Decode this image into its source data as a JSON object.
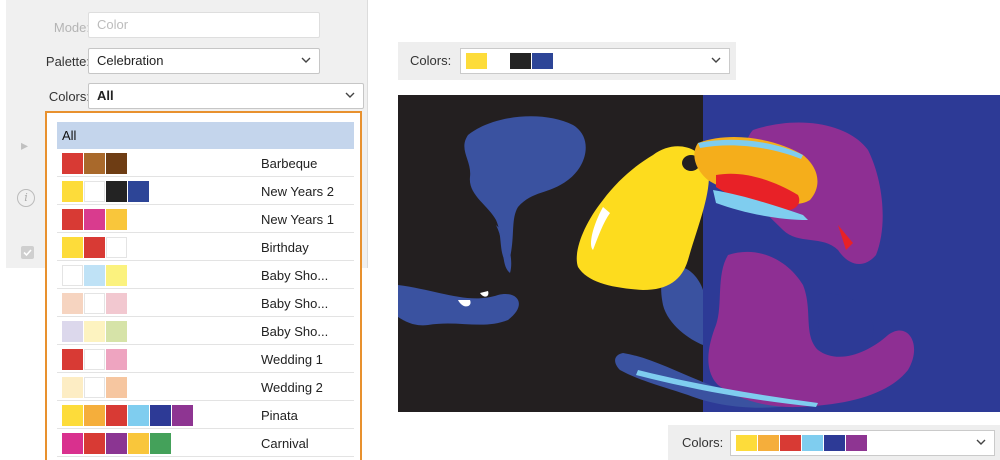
{
  "panel": {
    "mode": {
      "label": "Mode:",
      "value": "Color"
    },
    "palette": {
      "label": "Palette:",
      "value": "Celebration"
    },
    "colors": {
      "label": "Colors:",
      "value": "All"
    }
  },
  "dropdown": {
    "all_label": "All",
    "items": [
      {
        "name": "Barbeque",
        "swatches": [
          "#d83a34",
          "#a9692b",
          "#6e3d14"
        ]
      },
      {
        "name": "New Years 2",
        "swatches": [
          "#fddc3a",
          "#ffffff",
          "#232323",
          "#2d4597"
        ]
      },
      {
        "name": "New Years 1",
        "swatches": [
          "#d83a34",
          "#d93b8e",
          "#f9c63b"
        ]
      },
      {
        "name": "Birthday",
        "swatches": [
          "#fddc3a",
          "#d83a34",
          "#ffffff"
        ]
      },
      {
        "name": "Baby Sho...",
        "swatches": [
          "#ffffff",
          "#bfe2f6",
          "#fbf27e"
        ]
      },
      {
        "name": "Baby Sho...",
        "swatches": [
          "#f6d4c0",
          "#ffffff",
          "#f2c8d0"
        ]
      },
      {
        "name": "Baby Sho...",
        "swatches": [
          "#dcd8ec",
          "#fdf3c0",
          "#d6e3a8"
        ]
      },
      {
        "name": "Wedding 1",
        "swatches": [
          "#d83a34",
          "#ffffff",
          "#eea4c0"
        ]
      },
      {
        "name": "Wedding 2",
        "swatches": [
          "#fdedc4",
          "#ffffff",
          "#f6c6a0"
        ]
      },
      {
        "name": "Pinata",
        "swatches": [
          "#fddc3a",
          "#f5ae3b",
          "#d83a34",
          "#7fcdef",
          "#2d3a96",
          "#8e3592"
        ]
      },
      {
        "name": "Carnival",
        "swatches": [
          "#d9308e",
          "#d83a34",
          "#8b3592",
          "#f9c63b",
          "#44a15a"
        ]
      }
    ]
  },
  "colors_top": {
    "label": "Colors:",
    "swatches": [
      "#fddc3a",
      "#ffffff",
      "#232323",
      "#2d4597"
    ]
  },
  "colors_bottom": {
    "label": "Colors:",
    "swatches": [
      "#fddc3a",
      "#f5ae3b",
      "#d83a34",
      "#7fcdef",
      "#2d3a96",
      "#8e3592"
    ]
  },
  "art_colors": {
    "left_bg": "#231f20",
    "right_bg": "#2d3a96",
    "blue_shape": "#3a52a0",
    "yellow": "#fddc1e",
    "orange": "#f5ae1b",
    "red": "#e82127",
    "cyan": "#7fcdef",
    "purple": "#8e2f93"
  }
}
